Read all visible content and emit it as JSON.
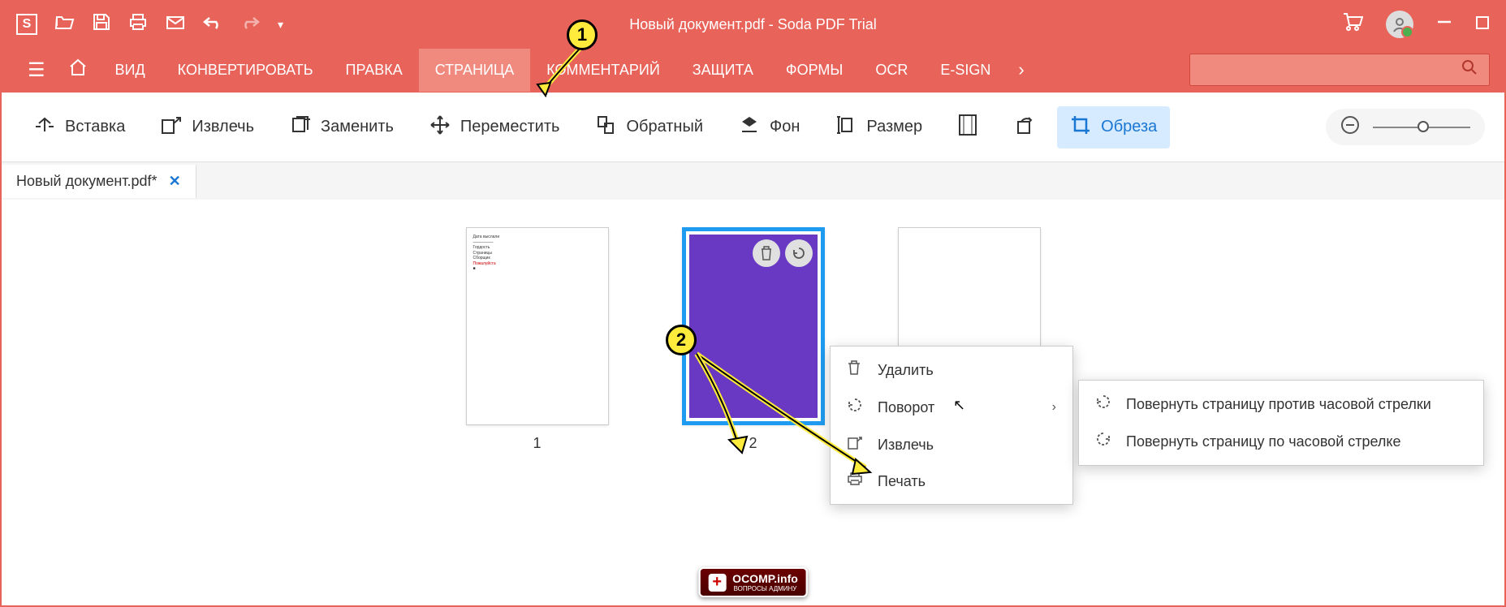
{
  "titlebar": {
    "logo": "S",
    "doc_title": "Новый документ.pdf   -   Soda PDF Trial"
  },
  "menubar": {
    "items": [
      "ВИД",
      "КОНВЕРТИРОВАТЬ",
      "ПРАВКА",
      "СТРАНИЦА",
      "КОММЕНТАРИЙ",
      "ЗАЩИТА",
      "ФОРМЫ",
      "OCR",
      "E-SIGN"
    ],
    "active_index": 3
  },
  "toolbar": {
    "tools": [
      {
        "label": "Вставка"
      },
      {
        "label": "Извлечь"
      },
      {
        "label": "Заменить"
      },
      {
        "label": "Переместить"
      },
      {
        "label": "Обратный"
      },
      {
        "label": "Фон"
      },
      {
        "label": "Размер"
      }
    ],
    "crop_label": "Обреза"
  },
  "tab": {
    "name": "Новый документ.pdf*"
  },
  "pages": {
    "p1": "1",
    "p2": "2"
  },
  "context_menu": {
    "items": [
      {
        "label": "Удалить"
      },
      {
        "label": "Поворот",
        "has_sub": true
      },
      {
        "label": "Извлечь"
      },
      {
        "label": "Печать"
      }
    ]
  },
  "submenu": {
    "items": [
      {
        "label": "Повернуть страницу против часовой стрелки"
      },
      {
        "label": "Повернуть страницу по часовой стрелке"
      }
    ]
  },
  "callouts": {
    "c1": "1",
    "c2": "2"
  },
  "watermark": {
    "main": "OCOMP.info",
    "sub": "ВОПРОСЫ АДМИНУ"
  }
}
